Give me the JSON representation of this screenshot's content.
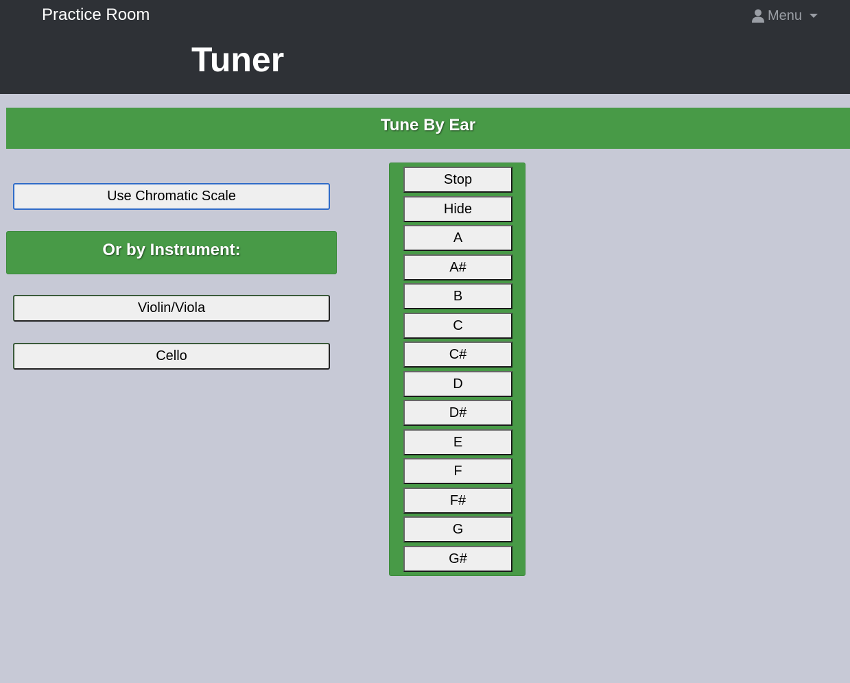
{
  "navbar": {
    "brand": "Practice Room",
    "menu_label": "Menu",
    "menu_icon": "user-icon"
  },
  "page_title": "Tuner",
  "banner": {
    "title": "Tune By Ear"
  },
  "left": {
    "chromatic_button": "Use Chromatic Scale",
    "instrument_header": "Or by Instrument:",
    "instruments": [
      "Violin/Viola",
      "Cello"
    ]
  },
  "note_panel": {
    "controls": [
      "Stop",
      "Hide"
    ],
    "notes": [
      "A",
      "A#",
      "B",
      "C",
      "C#",
      "D",
      "D#",
      "E",
      "F",
      "F#",
      "G",
      "G#"
    ]
  },
  "colors": {
    "navbar_bg": "#2e3136",
    "page_bg": "#c7c9d6",
    "accent_green": "#489a47",
    "button_bg": "#efefef",
    "focus_blue": "#2f6bc8"
  }
}
